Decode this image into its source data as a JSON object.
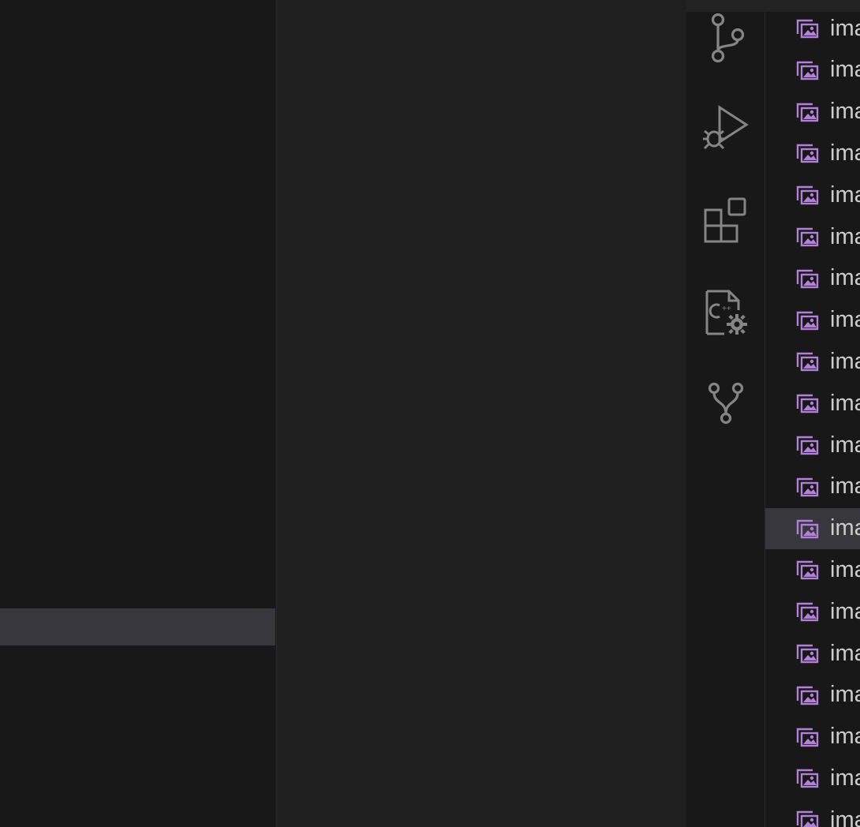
{
  "activity_bar": {
    "items": [
      {
        "name": "source-control-icon"
      },
      {
        "name": "run-and-debug-icon"
      },
      {
        "name": "extensions-icon"
      },
      {
        "name": "cpp-config-icon"
      },
      {
        "name": "git-graph-icon"
      }
    ]
  },
  "explorer": {
    "files": [
      {
        "label": "ima",
        "icon": "image-file-icon"
      },
      {
        "label": "ima",
        "icon": "image-file-icon"
      },
      {
        "label": "ima",
        "icon": "image-file-icon"
      },
      {
        "label": "ima",
        "icon": "image-file-icon"
      },
      {
        "label": "ima",
        "icon": "image-file-icon"
      },
      {
        "label": "ima",
        "icon": "image-file-icon"
      },
      {
        "label": "ima",
        "icon": "image-file-icon"
      },
      {
        "label": "ima",
        "icon": "image-file-icon"
      },
      {
        "label": "ima",
        "icon": "image-file-icon"
      },
      {
        "label": "ima",
        "icon": "image-file-icon"
      },
      {
        "label": "ima",
        "icon": "image-file-icon"
      },
      {
        "label": "ima",
        "icon": "image-file-icon"
      },
      {
        "label": "ima",
        "icon": "image-file-icon",
        "selected": true
      },
      {
        "label": "ima",
        "icon": "image-file-icon"
      },
      {
        "label": "ima",
        "icon": "image-file-icon"
      },
      {
        "label": "ima",
        "icon": "image-file-icon"
      },
      {
        "label": "ima",
        "icon": "image-file-icon"
      },
      {
        "label": "ima",
        "icon": "image-file-icon"
      },
      {
        "label": "ima",
        "icon": "image-file-icon"
      },
      {
        "label": "ima",
        "icon": "image-file-icon"
      }
    ]
  },
  "colors": {
    "image_icon": "#b180d7",
    "activity_icon": "#858585",
    "selection": "#37373d"
  }
}
